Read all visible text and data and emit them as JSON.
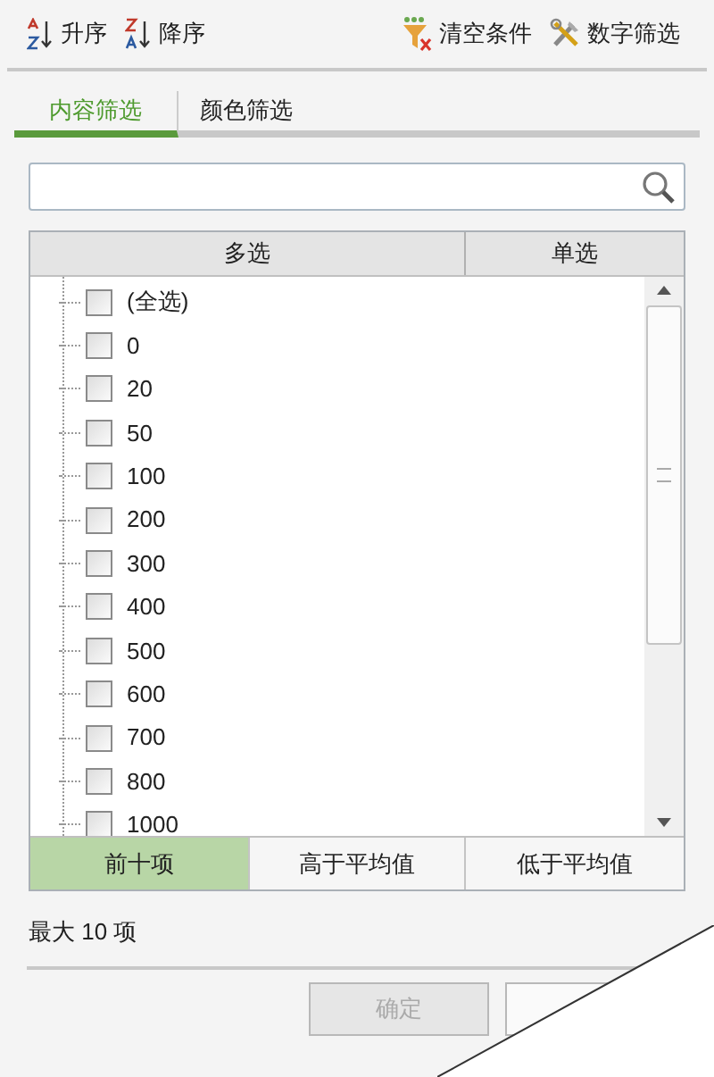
{
  "toolbar": [
    {
      "kind": "sort-asc",
      "label": "升序"
    },
    {
      "kind": "sort-desc",
      "label": "降序"
    },
    {
      "kind": "clear",
      "label": "清空条件"
    },
    {
      "kind": "number",
      "label": "数字筛选"
    }
  ],
  "tabs": [
    {
      "label": "内容筛选",
      "selected": true
    },
    {
      "label": "颜色筛选",
      "selected": false
    }
  ],
  "modes": [
    {
      "label": "多选",
      "selected": false
    },
    {
      "label": "单选",
      "selected": false
    }
  ],
  "items": [
    {
      "label": "(全选)",
      "checked": false
    },
    {
      "label": "0",
      "checked": false
    },
    {
      "label": "20",
      "checked": false
    },
    {
      "label": "50",
      "checked": false
    },
    {
      "label": "100",
      "checked": false
    },
    {
      "label": "200",
      "checked": false
    },
    {
      "label": "300",
      "checked": false
    },
    {
      "label": "400",
      "checked": false
    },
    {
      "label": "500",
      "checked": false
    },
    {
      "label": "600",
      "checked": false
    },
    {
      "label": "700",
      "checked": false
    },
    {
      "label": "800",
      "checked": false
    },
    {
      "label": "1000",
      "checked": false
    }
  ],
  "quick_filters": [
    {
      "label": "前十项",
      "selected": true
    },
    {
      "label": "高于平均值",
      "selected": false
    },
    {
      "label": "低于平均值",
      "selected": false
    }
  ],
  "caption": "最大 10 项",
  "buttons": [
    {
      "label": "确定",
      "disabled": true
    },
    {
      "disabled": false
    }
  ]
}
